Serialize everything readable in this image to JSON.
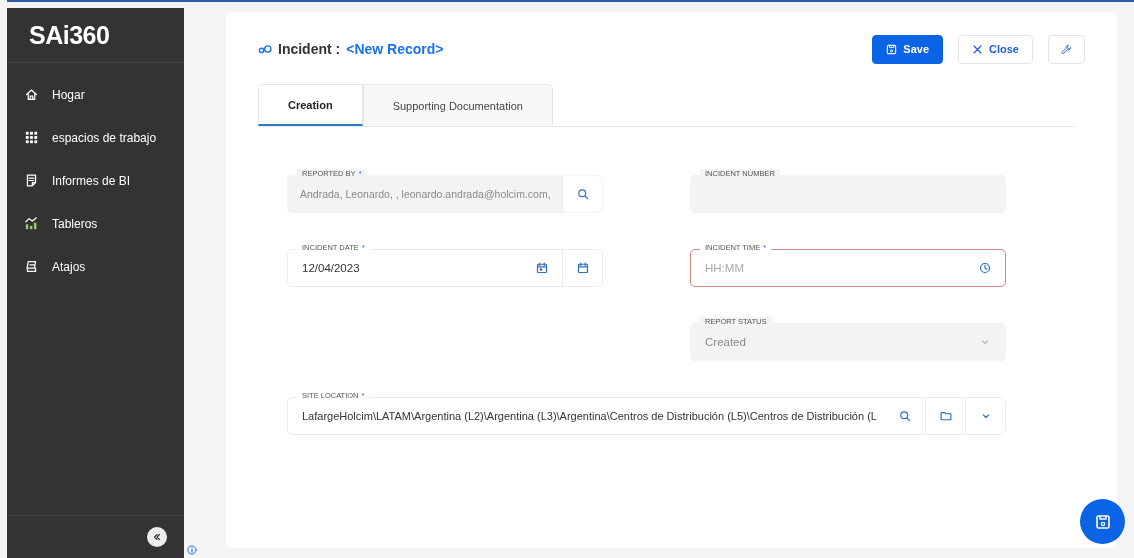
{
  "sidebar": {
    "logo": "SAi360",
    "items": [
      {
        "label": "Hogar"
      },
      {
        "label": "espacios de trabajo"
      },
      {
        "label": "Informes de BI"
      },
      {
        "label": "Tableros"
      },
      {
        "label": "Atajos"
      }
    ]
  },
  "header": {
    "title": "Incident :",
    "record": "<New Record>",
    "buttons": [
      {
        "kind": "primary",
        "label": "Save"
      },
      {
        "kind": "secondary",
        "label": "Close"
      },
      {
        "kind": "tool"
      }
    ]
  },
  "tabs": [
    {
      "label": "Creation",
      "selected": true
    },
    {
      "label": "Supporting Documentation",
      "selected": false
    }
  ],
  "form_rows": [
    {
      "left": {
        "kind": "lookup",
        "label": "REPORTED BY",
        "required_mark": "*",
        "value": "Andrada, Leonardo, , leonardo.andrada@holcim.com,",
        "disabled": true,
        "invalid": false
      },
      "right": {
        "kind": "text",
        "label": "INCIDENT NUMBER",
        "disabled": true,
        "invalid": false
      }
    },
    {
      "left": {
        "kind": "date",
        "label": "INCIDENT DATE",
        "required_mark": "*",
        "value": "12/04/2023",
        "disabled": false,
        "invalid": false
      },
      "right": {
        "kind": "time",
        "label": "INCIDENT TIME",
        "required_mark": "*",
        "placeholder": "HH:MM",
        "disabled": false,
        "invalid": true
      }
    },
    {
      "right": {
        "kind": "select",
        "label": "REPORT STATUS",
        "value": "Created",
        "disabled": true,
        "invalid": false
      }
    },
    {
      "full": {
        "kind": "location",
        "label": "SITE LOCATION",
        "required_mark": "*",
        "value": "LafargeHolcim\\LATAM\\Argentina (L2)\\Argentina (L3)\\Argentina\\Centros de Distribución (L5)\\Centros de Distribución (L",
        "disabled": false,
        "invalid": false
      }
    }
  ]
}
